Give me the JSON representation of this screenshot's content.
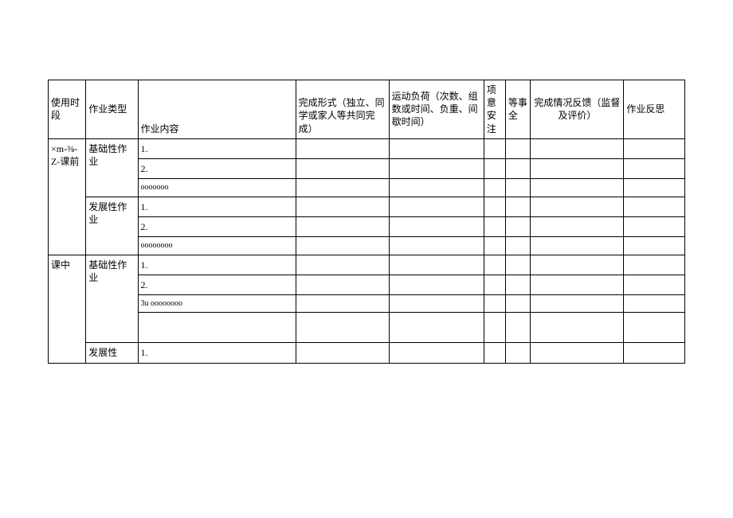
{
  "headers": {
    "phase": "使用时段",
    "type": "作业类型",
    "content": "作业内容",
    "form": "完成形式（独立、同学或家人等共同完成）",
    "load": "运动负荷（次数、组数或时间、负重、间歇时间）",
    "note": "项意安注",
    "safety": "等事全",
    "feedback": "完成情况反馈（监督及评价）",
    "reflect": "作业反思"
  },
  "phases": {
    "pre": "×m-⅜-Z-课前",
    "mid": "课中"
  },
  "types": {
    "basic": "基础性作业",
    "develop": "发展性作业",
    "develop_short": "发展性"
  },
  "rows": {
    "r1": "1.",
    "r2": "2.",
    "r_oo": "ooooooo",
    "r4": "1.",
    "r5": "2.",
    "r_oo2": "oooooooo",
    "r7": "1.",
    "r8": "2.",
    "r_3u": "3u oooooooo",
    "r10": "1."
  }
}
